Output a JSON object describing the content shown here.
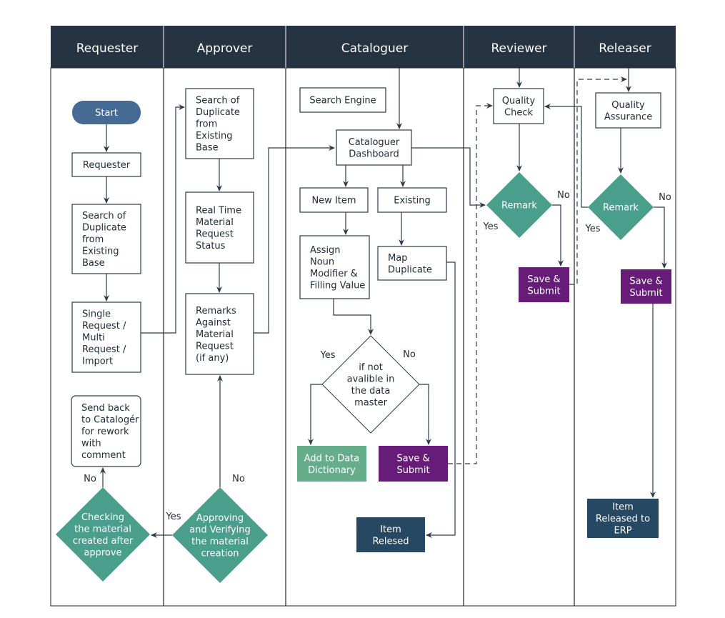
{
  "colors": {
    "header": "#263343",
    "start": "#456b94",
    "decision": "#4a9e8c",
    "submit": "#661c78",
    "dictionary": "#66ad8b",
    "released": "#264862",
    "line": "#2e3a48"
  },
  "lanes": [
    "Requester",
    "Approver",
    "Cataloguer",
    "Reviewer",
    "Releaser"
  ],
  "nodes": {
    "start": [
      "Start"
    ],
    "requester": [
      "Requester"
    ],
    "req_search": [
      "Search of",
      "Duplicate",
      "from",
      "Existing",
      "Base"
    ],
    "single_request": [
      "Single",
      "Request /",
      "Multi",
      "Request /",
      "Import"
    ],
    "send_back": [
      "Send back",
      "to Catalogér",
      "for rework",
      "with",
      "comment"
    ],
    "checking": [
      "Checking",
      "the material",
      "created after",
      "approve"
    ],
    "appr_search": [
      "Search of",
      "Duplicate",
      "from",
      "Existing",
      "Base"
    ],
    "real_time": [
      "Real Time",
      "Material",
      "Request",
      "Status"
    ],
    "remarks": [
      "Remarks",
      "Against",
      "Material",
      "Request",
      "(if any)"
    ],
    "approving": [
      "Approving",
      "and Verifying",
      "the material",
      "creation"
    ],
    "search_engine": [
      "Search Engine"
    ],
    "dashboard": [
      "Cataloguer",
      "Dashboard"
    ],
    "new_item": [
      "New Item"
    ],
    "existing": [
      "Existing"
    ],
    "assign": [
      "Assign",
      "Noun",
      "Modifier &",
      "Filling Value"
    ],
    "map_dup": [
      "Map",
      "Duplicate"
    ],
    "if_not": [
      "if not",
      "avalible in",
      "the data",
      "master"
    ],
    "add_dict": [
      "Add to Data",
      "Dictionary"
    ],
    "cat_submit": [
      "Save &",
      "Submit"
    ],
    "item_relesed": [
      "Item",
      "Relesed"
    ],
    "quality_check": [
      "Quality",
      "Check"
    ],
    "rev_remark": [
      "Remark"
    ],
    "rev_submit": [
      "Save &",
      "Submit"
    ],
    "quality_assurance": [
      "Quality",
      "Assurance"
    ],
    "rel_remark": [
      "Remark"
    ],
    "rel_submit": [
      "Save &",
      "Submit"
    ],
    "erp": [
      "Item",
      "Released to",
      "ERP"
    ]
  },
  "edge_labels": {
    "checking_no": "No",
    "approving_no": "No",
    "approving_yes": "Yes",
    "if_yes": "Yes",
    "if_no": "No",
    "rev_no": "No",
    "rev_yes": "Yes",
    "rel_no": "No",
    "rel_yes": "Yes"
  }
}
